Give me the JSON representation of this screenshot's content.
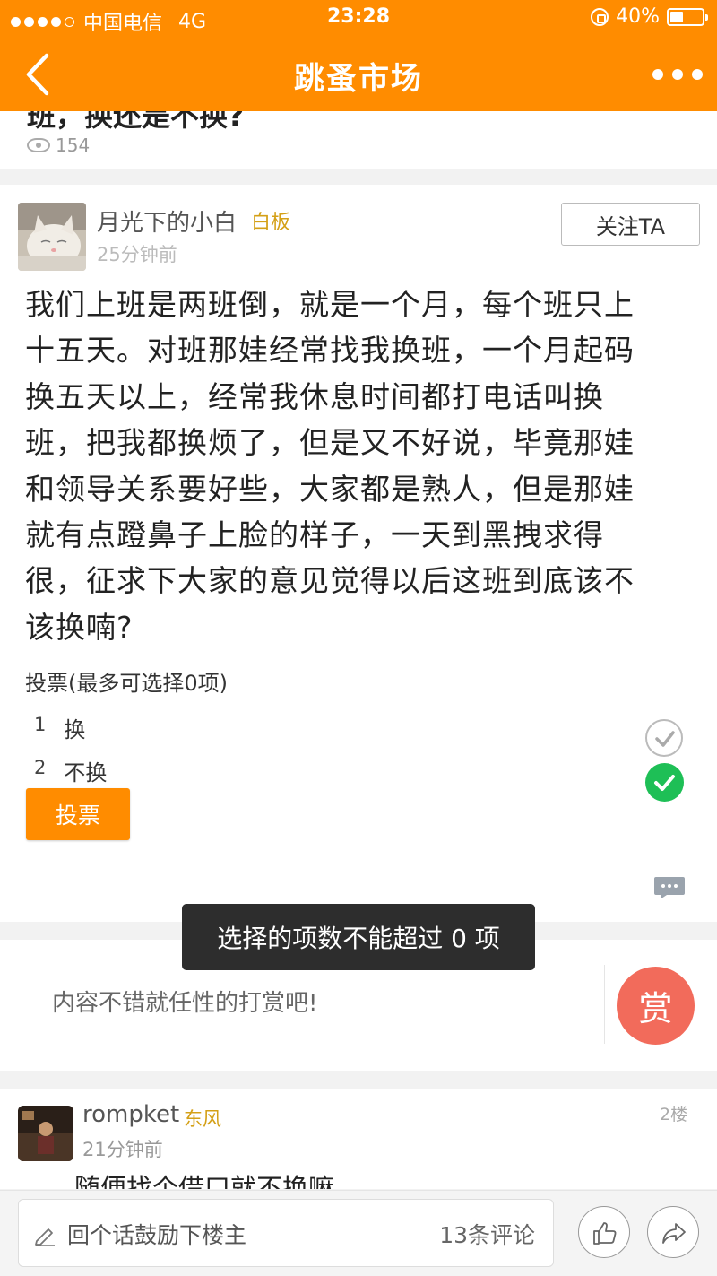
{
  "status_bar": {
    "carrier": "中国电信",
    "network": "4G",
    "time": "23:28",
    "battery": "40%",
    "battery_level": 0.4
  },
  "nav": {
    "title": "跳蚤市场"
  },
  "prev_post": {
    "title": "班，换还是不换?",
    "views": "154"
  },
  "post": {
    "author": "月光下的小白",
    "rank": "白板",
    "time": "25分钟前",
    "follow_label": "关注TA",
    "body_lines": [
      "我们上班是两班倒，就是一个月，每个班只上",
      "十五天。对班那娃经常找我换班，一个月起码",
      "换五天以上，经常我休息时间都打电话叫换",
      "班，把我都换烦了，但是又不好说，毕竟那娃",
      "和领导关系要好些，大家都是熟人，但是那娃",
      "就有点蹬鼻子上脸的样子，一天到黑拽求得",
      "很，征求下大家的意见觉得以后这班到底该不",
      "该换喃?"
    ]
  },
  "vote": {
    "title": "投票(最多可选择0项)",
    "options": [
      {
        "num": "1",
        "label": "换",
        "selected": false
      },
      {
        "num": "2",
        "label": "不换",
        "selected": true
      }
    ],
    "button_label": "投票"
  },
  "toast": {
    "message": "选择的项数不能超过 0 项"
  },
  "reward": {
    "prompt": "内容不错就任性的打赏吧!",
    "button_label": "赏"
  },
  "comment": {
    "author": "rompket",
    "rank": "东风",
    "time": "21分钟前",
    "floor": "2楼",
    "text": "随便找个借口就不换嘛"
  },
  "bottom_bar": {
    "reply_placeholder": "回个话鼓励下楼主",
    "comment_count": "13条评论"
  },
  "colors": {
    "accent": "#ff8c00",
    "selected_check": "#1ebf56",
    "reward": "#f26b5b",
    "rank": "#d4a017"
  },
  "icons": [
    "back-arrow-icon",
    "more-dots-icon",
    "eye-icon",
    "check-off-icon",
    "check-on-icon",
    "comment-bubble-icon",
    "pen-icon",
    "thumbs-up-icon",
    "share-icon",
    "lock-icon",
    "battery-icon"
  ]
}
